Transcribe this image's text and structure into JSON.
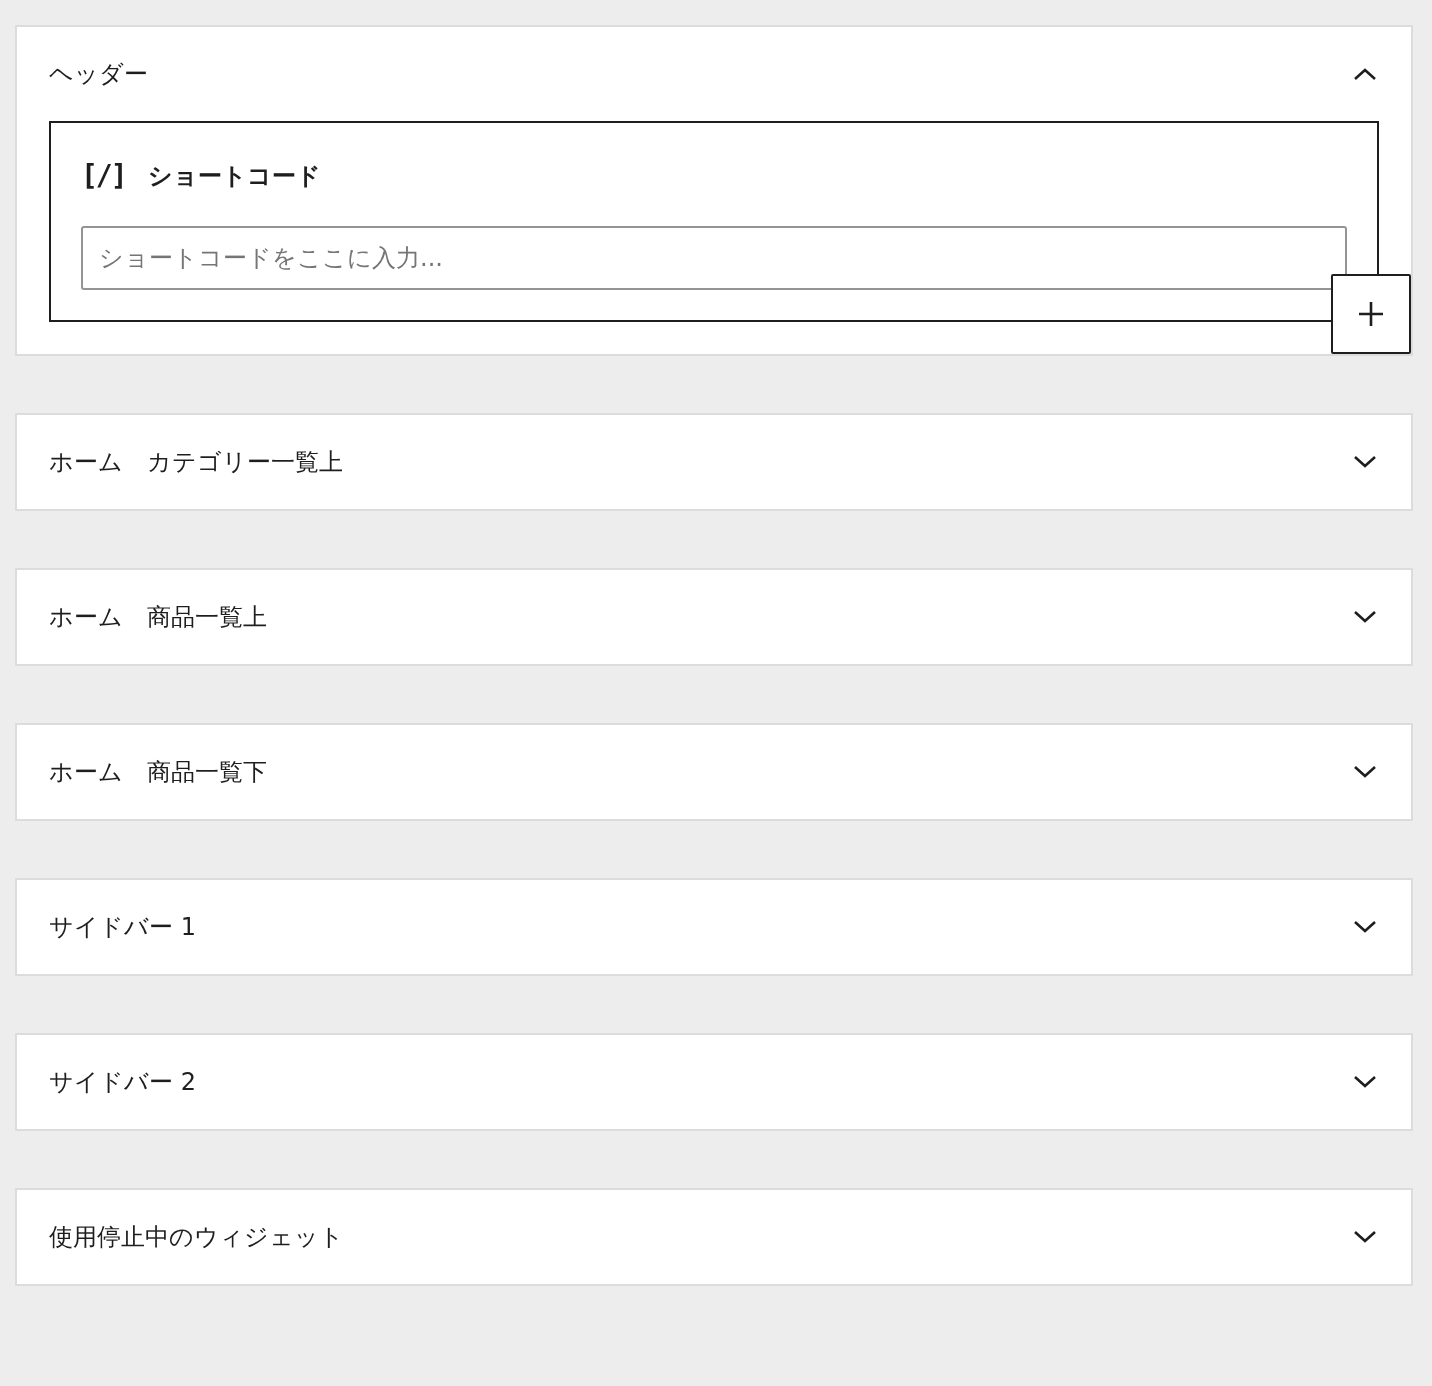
{
  "areas": [
    {
      "title": "ヘッダー",
      "expanded": true,
      "block": {
        "icon": "[/]",
        "title": "ショートコード",
        "placeholder": "ショートコードをここに入力..."
      }
    },
    {
      "title": "ホーム　カテゴリー一覧上",
      "expanded": false
    },
    {
      "title": "ホーム　商品一覧上",
      "expanded": false
    },
    {
      "title": "ホーム　商品一覧下",
      "expanded": false
    },
    {
      "title": "サイドバー 1",
      "expanded": false
    },
    {
      "title": "サイドバー 2",
      "expanded": false
    },
    {
      "title": "使用停止中のウィジェット",
      "expanded": false
    }
  ]
}
